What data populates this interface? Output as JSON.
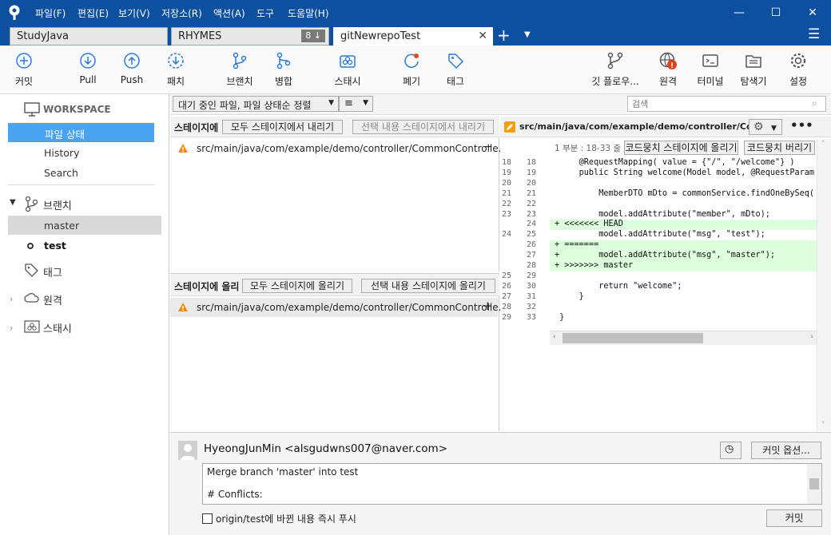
{
  "menu": [
    "파일(F)",
    "편집(E)",
    "보기(V)",
    "저장소(R)",
    "액션(A)",
    "도구",
    "도움말(H)"
  ],
  "tabs": [
    {
      "label": "StudyJava"
    },
    {
      "label": "RHYMES",
      "badge": "8 ↓"
    },
    {
      "label": "gitNewrepoTest"
    }
  ],
  "toolbar": {
    "commit": "커밋",
    "pull": "Pull",
    "push": "Push",
    "fetch": "패치",
    "branch": "브랜치",
    "merge": "병합",
    "stash": "스태시",
    "discard": "폐기",
    "tag": "태그",
    "gitflow": "깃 플로우...",
    "remote": "원격",
    "terminal": "터미널",
    "explorer": "탐색기",
    "settings": "설정"
  },
  "sidebar": {
    "workspace": "WORKSPACE",
    "file_status": "파일 상태",
    "history": "History",
    "search": "Search",
    "branches": "브랜치",
    "branch_items": [
      "master",
      "test"
    ],
    "tags": "태그",
    "remotes": "원격",
    "stashes": "스태시"
  },
  "filter": {
    "sort": "대기 중인 파일, 파일 상태순 정렬",
    "list_icon": "≡",
    "search_placeholder": "검색"
  },
  "staged": {
    "header": "스테이지에",
    "unstage_all": "모두 스테이지에서 내리기",
    "unstage_selected": "선택 내용 스테이지에서 내리기",
    "file": "src/main/java/com/example/demo/controller/CommonControlle..."
  },
  "unstaged": {
    "header": "스테이지에 올리",
    "stage_all": "모두 스테이지에 올리기",
    "stage_selected": "선택 내용 스테이지에 올리기",
    "file": "src/main/java/com/example/demo/controller/CommonControlle..."
  },
  "diff": {
    "path": "src/main/java/com/example/demo/controller/Com...",
    "hunk": "1 부분 : 18-33 줄",
    "stage_hunk": "코드뭉치 스테이지에 올리기",
    "discard_hunk": "코드뭉치 버리기",
    "lines": [
      {
        "old": "18",
        "new": "18",
        "type": "ctx",
        "text": "     @RequestMapping( value = {\"/\", \"/welcome\"} )"
      },
      {
        "old": "19",
        "new": "19",
        "type": "ctx",
        "text": "     public String welcome(Model model, @RequestParam"
      },
      {
        "old": "20",
        "new": "20",
        "type": "ctx",
        "text": ""
      },
      {
        "old": "21",
        "new": "21",
        "type": "ctx",
        "text": "         MemberDTO mDto = commonService.findOneBySeq("
      },
      {
        "old": "22",
        "new": "22",
        "type": "ctx",
        "text": ""
      },
      {
        "old": "23",
        "new": "23",
        "type": "ctx",
        "text": "         model.addAttribute(\"member\", mDto);"
      },
      {
        "old": "",
        "new": "24",
        "type": "add",
        "text": "+ <<<<<<< HEAD"
      },
      {
        "old": "24",
        "new": "25",
        "type": "ctx",
        "text": "         model.addAttribute(\"msg\", \"test\");"
      },
      {
        "old": "",
        "new": "26",
        "type": "add",
        "text": "+ ======="
      },
      {
        "old": "",
        "new": "27",
        "type": "add",
        "text": "+        model.addAttribute(\"msg\", \"master\");"
      },
      {
        "old": "",
        "new": "28",
        "type": "add",
        "text": "+ >>>>>>> master"
      },
      {
        "old": "25",
        "new": "29",
        "type": "ctx",
        "text": ""
      },
      {
        "old": "26",
        "new": "30",
        "type": "ctx",
        "text": "         return \"welcome\";"
      },
      {
        "old": "27",
        "new": "31",
        "type": "ctx",
        "text": "     }"
      },
      {
        "old": "28",
        "new": "32",
        "type": "ctx",
        "text": ""
      },
      {
        "old": "29",
        "new": "33",
        "type": "ctx",
        "text": " }"
      }
    ]
  },
  "commit": {
    "author": "HyeongJunMin <alsgudwns007@naver.com>",
    "options": "커밋 옵션...",
    "message_line1": "Merge branch 'master' into test",
    "message_line2": "",
    "message_line3": "# Conflicts:",
    "push_label": "origin/test에 바뀐 내용 즉시 푸시",
    "commit_button": "커밋"
  },
  "colors": {
    "titlebar": "#0e50a0",
    "selected": "#4aa3ee",
    "added": "#ddffdd",
    "warning": "#f08c00"
  }
}
